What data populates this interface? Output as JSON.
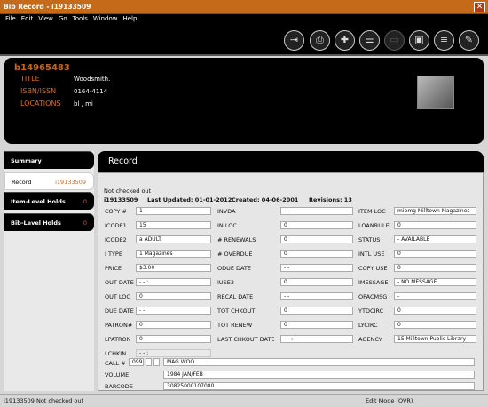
{
  "window": {
    "title": "Bib Record - i19133509"
  },
  "menu": [
    "File",
    "Edit",
    "View",
    "Go",
    "Tools",
    "Window",
    "Help"
  ],
  "toolbar": {
    "icons": [
      "save-close-icon",
      "print-icon",
      "new-record-icon",
      "record-list-icon",
      "blank-disabled-icon",
      "view-icon",
      "summary-icon",
      "edit-record-icon"
    ]
  },
  "header": {
    "bib_number": "b14965483",
    "title_label": "TITLE",
    "title_value": "Woodsmith.",
    "isbn_label": "ISBN/ISSN",
    "isbn_value": "0164-4114",
    "locations_label": "LOCATIONS",
    "locations_value": "bl   , mi"
  },
  "sidebar": [
    {
      "label": "Summary",
      "count": ""
    },
    {
      "label": "Record",
      "count": "i19133509"
    },
    {
      "label": "Item-Level Holds",
      "count": "0"
    },
    {
      "label": "Bib-Level Holds",
      "count": "0"
    }
  ],
  "record": {
    "heading": "Record",
    "status_note": "Not checked out",
    "id": "i19133509",
    "last_updated": "Last Updated: 01-01-2012",
    "created": "Created: 04-06-2001",
    "revisions": "Revisions: 13",
    "col1": [
      {
        "label": "COPY #",
        "value": "1"
      },
      {
        "label": "ICODE1",
        "value": "15"
      },
      {
        "label": "ICODE2",
        "value": "a  ADULT"
      },
      {
        "label": "I TYPE",
        "value": "1  Magazines"
      },
      {
        "label": "PRICE",
        "value": "$3.00"
      },
      {
        "label": "OUT DATE",
        "value": " -  -          :"
      },
      {
        "label": "OUT LOC",
        "value": "0"
      },
      {
        "label": "DUE DATE",
        "value": " -  -"
      },
      {
        "label": "PATRON#",
        "value": "0"
      },
      {
        "label": "LPATRON",
        "value": "0"
      },
      {
        "label": "LCHKIN",
        "value": " -  -          :"
      }
    ],
    "col2": [
      {
        "label": "INVDA",
        "value": " -  -"
      },
      {
        "label": "IN LOC",
        "value": "0"
      },
      {
        "label": "# RENEWALS",
        "value": "0"
      },
      {
        "label": "# OVERDUE",
        "value": "0"
      },
      {
        "label": "ODUE DATE",
        "value": " -  -"
      },
      {
        "label": "IUSE3",
        "value": "0"
      },
      {
        "label": "RECAL DATE",
        "value": " -  -"
      },
      {
        "label": "TOT CHKOUT",
        "value": "0"
      },
      {
        "label": "TOT RENEW",
        "value": "0"
      },
      {
        "label": "LAST CHKOUT DATE",
        "value": " -  -          :"
      }
    ],
    "col3": [
      {
        "label": "ITEM LOC",
        "value": "mibmg   Milltown Magazines"
      },
      {
        "label": "LOANRULE",
        "value": "0"
      },
      {
        "label": "STATUS",
        "value": "-  AVAILABLE"
      },
      {
        "label": "INTL USE",
        "value": "0"
      },
      {
        "label": "COPY USE",
        "value": "0"
      },
      {
        "label": "IMESSAGE",
        "value": "-  NO MESSAGE"
      },
      {
        "label": "OPACMSG",
        "value": "-"
      },
      {
        "label": "YTDCIRC",
        "value": "0"
      },
      {
        "label": "LYCIRC",
        "value": "0"
      },
      {
        "label": "AGENCY",
        "value": "15  Milltown Public Library"
      }
    ],
    "call_label": "CALL #",
    "call_tag": "099",
    "call_value": "MAG WOO",
    "volume_label": "VOLUME",
    "volume_value": "1984 JAN/FEB",
    "barcode_label": "BARCODE",
    "barcode_value": "30825000107080"
  },
  "status_bar": {
    "left": "i19133509  Not checked out",
    "right": "Edit Mode (OVR)"
  }
}
